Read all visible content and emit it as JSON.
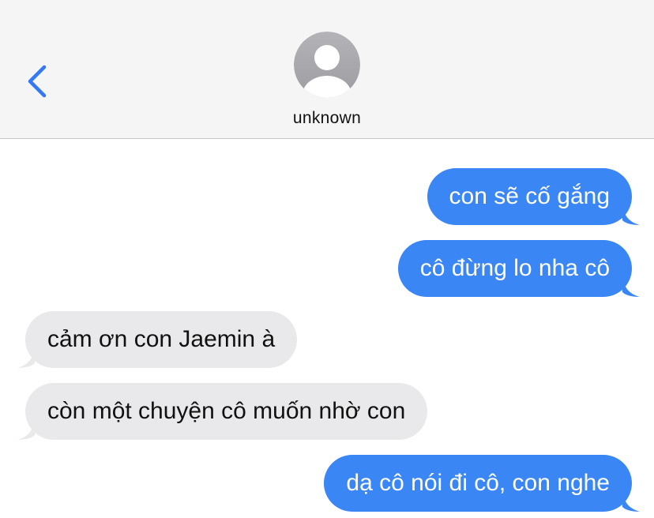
{
  "header": {
    "contact_name": "unknown",
    "back_icon": "chevron-left-icon",
    "avatar_icon": "person-silhouette-icon"
  },
  "colors": {
    "outgoing_bubble": "#3a86f4",
    "incoming_bubble": "#e9e9eb",
    "accent": "#3478f6",
    "header_bg": "#f5f5f5"
  },
  "messages": [
    {
      "direction": "outgoing",
      "text": "con sẽ cố gắng"
    },
    {
      "direction": "outgoing",
      "text": "cô đừng lo nha cô"
    },
    {
      "direction": "incoming",
      "text": "cảm ơn con Jaemin à"
    },
    {
      "direction": "incoming",
      "text": "còn một chuyện cô muốn nhờ con"
    },
    {
      "direction": "outgoing",
      "text": "dạ cô nói đi cô, con nghe"
    }
  ]
}
